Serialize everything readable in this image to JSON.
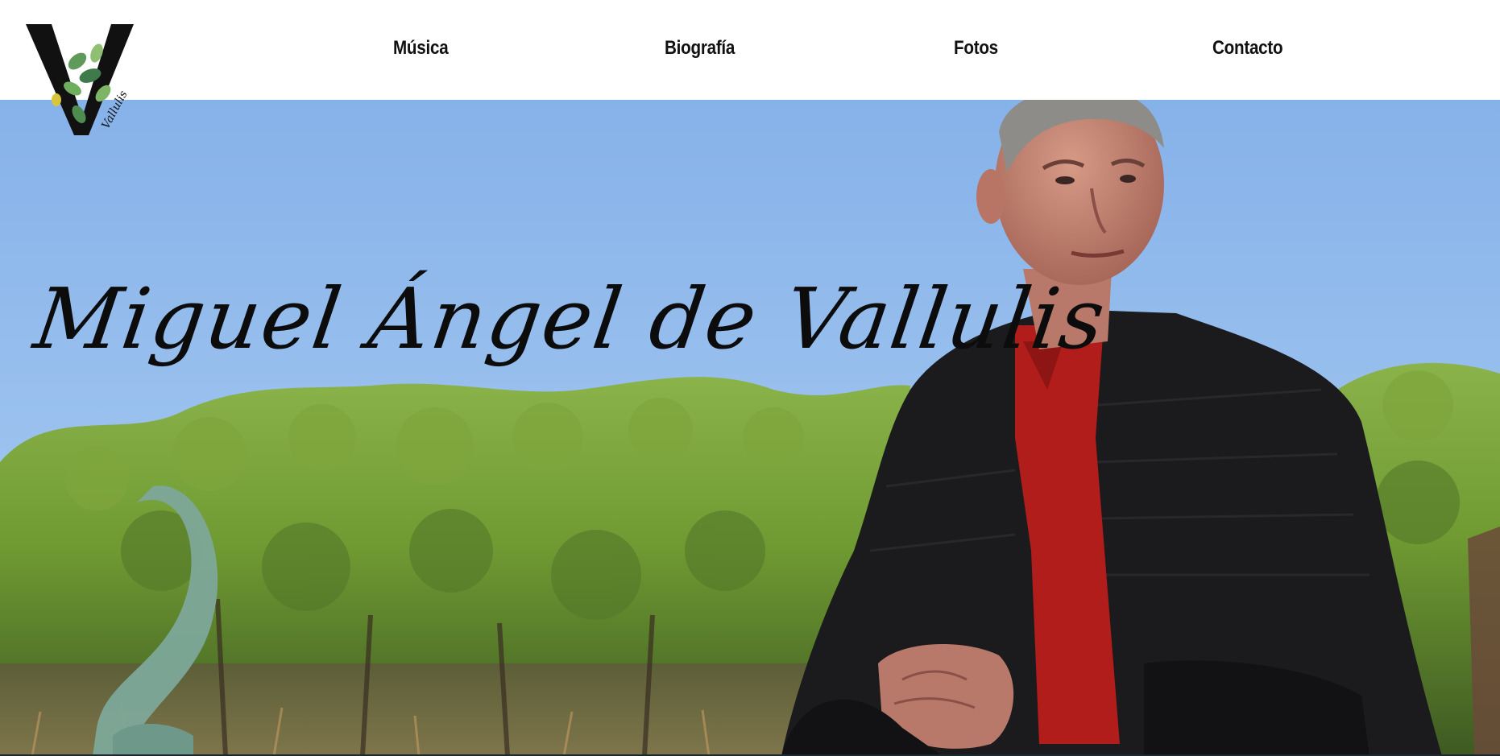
{
  "brand": {
    "logo_letter": "V",
    "logo_script": "Vallulis",
    "colors": {
      "leaf_dark": "#3f7a4a",
      "leaf_light": "#8fbf73",
      "leaf_yellow": "#d9c53a"
    }
  },
  "nav": {
    "items": [
      {
        "label": "Música"
      },
      {
        "label": "Biografía"
      },
      {
        "label": "Fotos"
      },
      {
        "label": "Contacto"
      }
    ]
  },
  "hero": {
    "title": "Miguel Ángel de Vallulis",
    "colors": {
      "sky": "#8fb8ea",
      "trees": "#7da23a",
      "jacket": "#1b1b1d",
      "shirt": "#b01d1a"
    }
  }
}
